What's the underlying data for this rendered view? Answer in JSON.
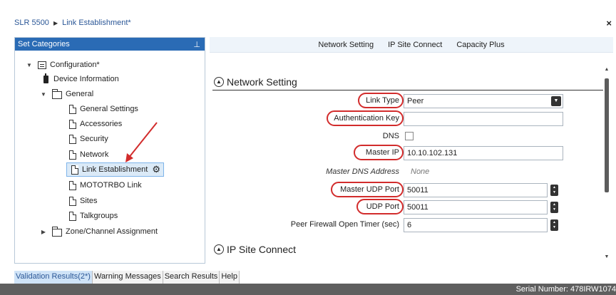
{
  "breadcrumb": {
    "root": "SLR 5500",
    "separator": "▶",
    "current": "Link Establishment*"
  },
  "close_glyph": "×",
  "left_panel": {
    "title": "Set Categories",
    "pin_glyph": "⊥",
    "tree": [
      {
        "label": "Configuration*",
        "icon": "config-icon",
        "expanded": true
      },
      {
        "label": "Device Information",
        "icon": "radio-icon"
      },
      {
        "label": "General",
        "icon": "folder-icon",
        "expanded": true
      },
      {
        "label": "General Settings",
        "icon": "doc-icon"
      },
      {
        "label": "Accessories",
        "icon": "doc-icon"
      },
      {
        "label": "Security",
        "icon": "doc-icon"
      },
      {
        "label": "Network",
        "icon": "doc-icon"
      },
      {
        "label": "Link Establishment",
        "icon": "doc-icon",
        "selected": true
      },
      {
        "label": "MOTOTRBO Link",
        "icon": "doc-icon"
      },
      {
        "label": "Sites",
        "icon": "doc-icon"
      },
      {
        "label": "Talkgroups",
        "icon": "doc-icon"
      },
      {
        "label": "Zone/Channel Assignment",
        "icon": "folder-icon",
        "expanded": false
      }
    ]
  },
  "tabs": [
    "Network Setting",
    "IP Site Connect",
    "Capacity Plus"
  ],
  "sections": {
    "network": "Network Setting",
    "ipsc": "IP Site Connect"
  },
  "fields": {
    "link_type": {
      "label": "Link Type",
      "value": "Peer"
    },
    "auth_key": {
      "label": "Authentication Key",
      "value": ""
    },
    "dns": {
      "label": "DNS"
    },
    "master_ip": {
      "label": "Master IP",
      "value": "10.10.102.131"
    },
    "master_dns": {
      "label": "Master DNS Address",
      "value": "None"
    },
    "master_udp": {
      "label": "Master UDP Port",
      "value": "50011"
    },
    "udp_port": {
      "label": "UDP Port",
      "value": "50011"
    },
    "firewall_timer": {
      "label": "Peer Firewall Open Timer (sec)",
      "value": "6"
    }
  },
  "bottom_tabs": [
    "Validation Results(2*)",
    "Warning Messages",
    "Search Results",
    "Help"
  ],
  "status": {
    "serial": "Serial Number: 478IRW1074"
  },
  "colors": {
    "accent": "#2a6bb5",
    "annotation": "#d22c2c"
  }
}
